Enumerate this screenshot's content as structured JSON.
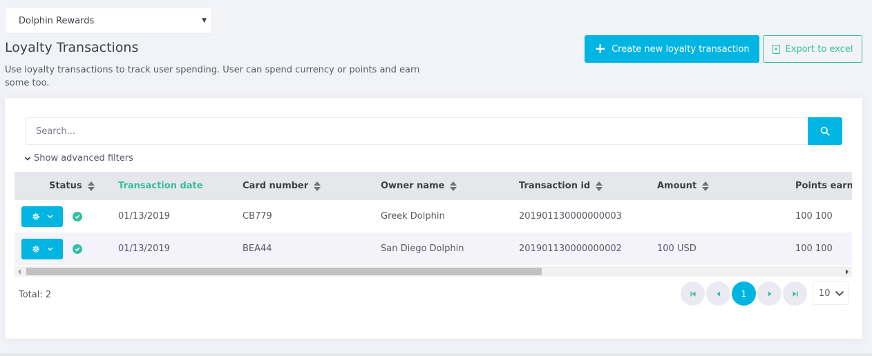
{
  "tenant_select": {
    "value": "Dolphin Rewards"
  },
  "page": {
    "title": "Loyalty Transactions",
    "description": "Use loyalty transactions to track user spending. User can spend currency or points and earn some too."
  },
  "toolbar": {
    "create_label": "Create new loyalty transaction",
    "export_label": "Export to excel",
    "export_icon_text": "x"
  },
  "search": {
    "placeholder": "Search...",
    "advanced_filters_label": "Show advanced filters"
  },
  "table": {
    "columns": [
      {
        "label": "Status",
        "sortable": true,
        "active": false
      },
      {
        "label": "Transaction date",
        "sortable": false,
        "active": true
      },
      {
        "label": "Card number",
        "sortable": true,
        "active": false
      },
      {
        "label": "Owner name",
        "sortable": true,
        "active": false
      },
      {
        "label": "Transaction id",
        "sortable": true,
        "active": false
      },
      {
        "label": "Amount",
        "sortable": true,
        "active": false
      },
      {
        "label": "Points earned",
        "sortable": false,
        "active": false
      }
    ],
    "rows": [
      {
        "status": "active",
        "date": "01/13/2019",
        "card_number": "CB779",
        "owner_name": "Greek Dolphin",
        "transaction_id": "201901130000000003",
        "amount": "",
        "points_earned": "100 100"
      },
      {
        "status": "active",
        "date": "01/13/2019",
        "card_number": "BEA44",
        "owner_name": "San Diego Dolphin",
        "transaction_id": "201901130000000002",
        "amount": "100 USD",
        "points_earned": "100 100"
      }
    ]
  },
  "footer": {
    "total_label": "Total: 2",
    "current_page": "1",
    "page_size": "10"
  },
  "colors": {
    "primary": "#00b5e2",
    "success": "#34bfa3",
    "background": "#f2f3f8"
  }
}
